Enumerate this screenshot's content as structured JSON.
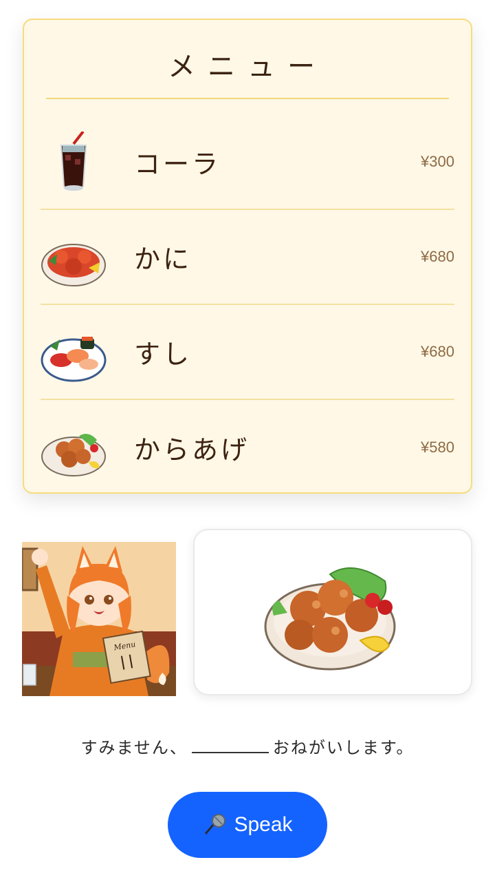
{
  "menu": {
    "title": "メニュー",
    "items": [
      {
        "name": "コーラ",
        "price": "¥300",
        "icon": "cola-icon"
      },
      {
        "name": "かに",
        "price": "¥680",
        "icon": "crab-icon"
      },
      {
        "name": "すし",
        "price": "¥680",
        "icon": "sushi-icon"
      },
      {
        "name": "からあげ",
        "price": "¥580",
        "icon": "karaage-icon"
      }
    ]
  },
  "character_menu_text": "Menu",
  "prompt": {
    "before": "すみません、",
    "after": "おねがいします。"
  },
  "speak_button": {
    "label": "Speak",
    "icon": "microphone-icon"
  },
  "colors": {
    "menu_bg": "#fff8e7",
    "menu_border": "#f6dc7c",
    "button": "#1463ff"
  }
}
